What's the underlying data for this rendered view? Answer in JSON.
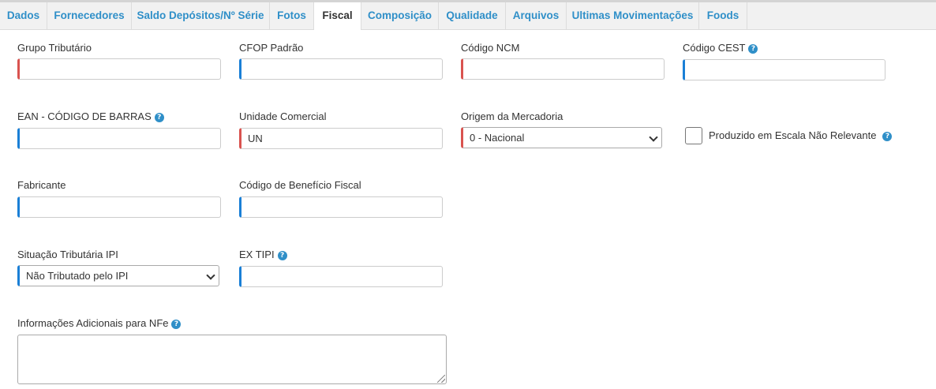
{
  "tabs": [
    {
      "label": "Dados"
    },
    {
      "label": "Fornecedores"
    },
    {
      "label": "Saldo Depósitos/Nº Série"
    },
    {
      "label": "Fotos"
    },
    {
      "label": "Fiscal"
    },
    {
      "label": "Composição"
    },
    {
      "label": "Qualidade"
    },
    {
      "label": "Arquivos"
    },
    {
      "label": "Ultimas Movimentações"
    },
    {
      "label": "Foods"
    }
  ],
  "active_tab": "Fiscal",
  "fields": {
    "grupo_tributario": {
      "label": "Grupo Tributário",
      "value": ""
    },
    "cfop_padrao": {
      "label": "CFOP Padrão",
      "value": ""
    },
    "codigo_ncm": {
      "label": "Código NCM",
      "value": ""
    },
    "codigo_cest": {
      "label": "Código CEST",
      "value": ""
    },
    "ean": {
      "label": "EAN - CÓDIGO DE BARRAS",
      "value": ""
    },
    "unidade_comercial": {
      "label": "Unidade Comercial",
      "value": "UN"
    },
    "origem_mercadoria": {
      "label": "Origem da Mercadoria",
      "selected": "0 - Nacional"
    },
    "escala_nao_relevante": {
      "label": "Produzido em Escala Não Relevante",
      "checked": false
    },
    "fabricante": {
      "label": "Fabricante",
      "value": ""
    },
    "codigo_beneficio_fiscal": {
      "label": "Código de Benefício Fiscal",
      "value": ""
    },
    "situacao_tributaria_ipi": {
      "label": "Situação Tributária IPI",
      "selected": "Não Tributado pelo IPI"
    },
    "ex_tipi": {
      "label": "EX TIPI",
      "value": ""
    },
    "info_adicionais_nfe": {
      "label": "Informações Adicionais para NFe",
      "value": ""
    }
  },
  "help_icon_glyph": "?",
  "colors": {
    "tab_text": "#2f8fc8",
    "required_marker": "#d9534f",
    "optional_marker": "#1a7fd6",
    "help_icon": "#2f8fc8"
  }
}
